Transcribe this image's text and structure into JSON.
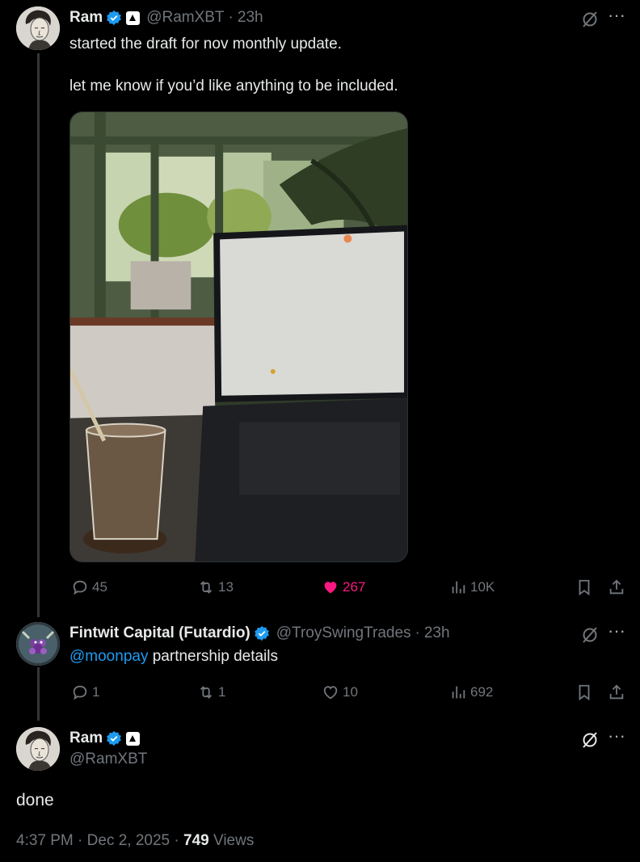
{
  "colors": {
    "background": "#000000",
    "text": "#e7e9ea",
    "muted": "#71767b",
    "link": "#1d9bf0",
    "like": "#f91880",
    "verified": "#1d9bf0"
  },
  "post1": {
    "author": "Ram",
    "handle": "@RamXBT",
    "sep": "·",
    "time": "23h",
    "text_line1": "started the draft for nov monthly update.",
    "text_line2": "let me know if you’d like anything to be included.",
    "image_icon": "cafe-laptop-photo",
    "replies": "45",
    "reposts": "13",
    "likes": "267",
    "views": "10K"
  },
  "post2": {
    "author": "Fintwit Capital (Futardio)",
    "handle": "@TroySwingTrades",
    "sep": "·",
    "time": "23h",
    "mention": "@moonpay",
    "text": " partnership details",
    "replies": "1",
    "reposts": "1",
    "likes": "10",
    "views": "692"
  },
  "post3": {
    "author": "Ram",
    "handle": "@RamXBT",
    "text": "done",
    "time": "4:37 PM",
    "date": "Dec 2, 2025",
    "sep": "·",
    "views_count": "749",
    "views_label": "Views"
  }
}
